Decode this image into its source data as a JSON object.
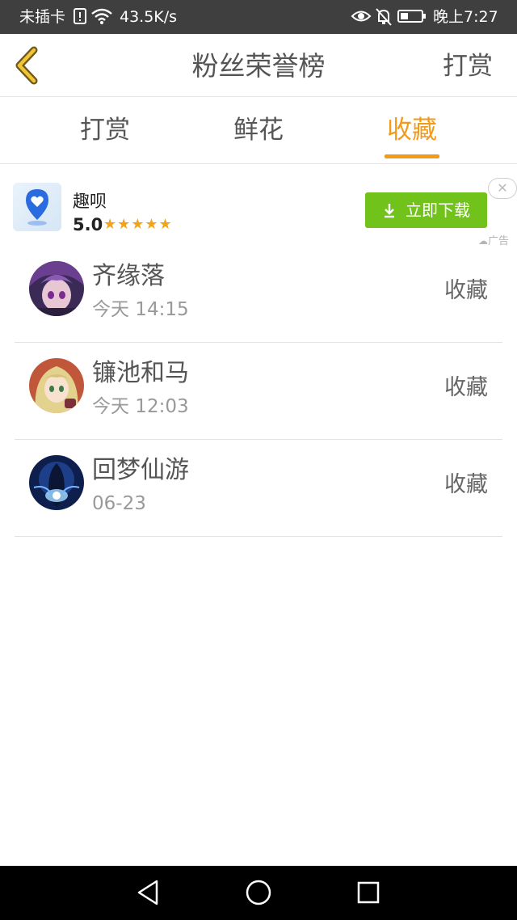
{
  "status_bar": {
    "carrier": "未插卡",
    "speed": "43.5K/s",
    "time": "晚上7:27"
  },
  "nav": {
    "title": "粉丝荣誉榜",
    "right_action": "打赏"
  },
  "tabs": [
    {
      "label": "打赏",
      "active": false
    },
    {
      "label": "鲜花",
      "active": false
    },
    {
      "label": "收藏",
      "active": true
    }
  ],
  "ad": {
    "app_name": "趣呗",
    "rating": "5.0",
    "stars": "★★★★★",
    "button_label": "立即下载",
    "close": "✕",
    "mark": "广告"
  },
  "list": [
    {
      "name": "齐缘落",
      "time": "今天 14:15",
      "action": "收藏"
    },
    {
      "name": "镰池和马",
      "time": "今天 12:03",
      "action": "收藏"
    },
    {
      "name": "回梦仙游",
      "time": "06-23",
      "action": "收藏"
    }
  ],
  "colors": {
    "accent": "#f29b1a",
    "ad_button": "#71c21b",
    "status_bar": "#3f3f3f"
  }
}
